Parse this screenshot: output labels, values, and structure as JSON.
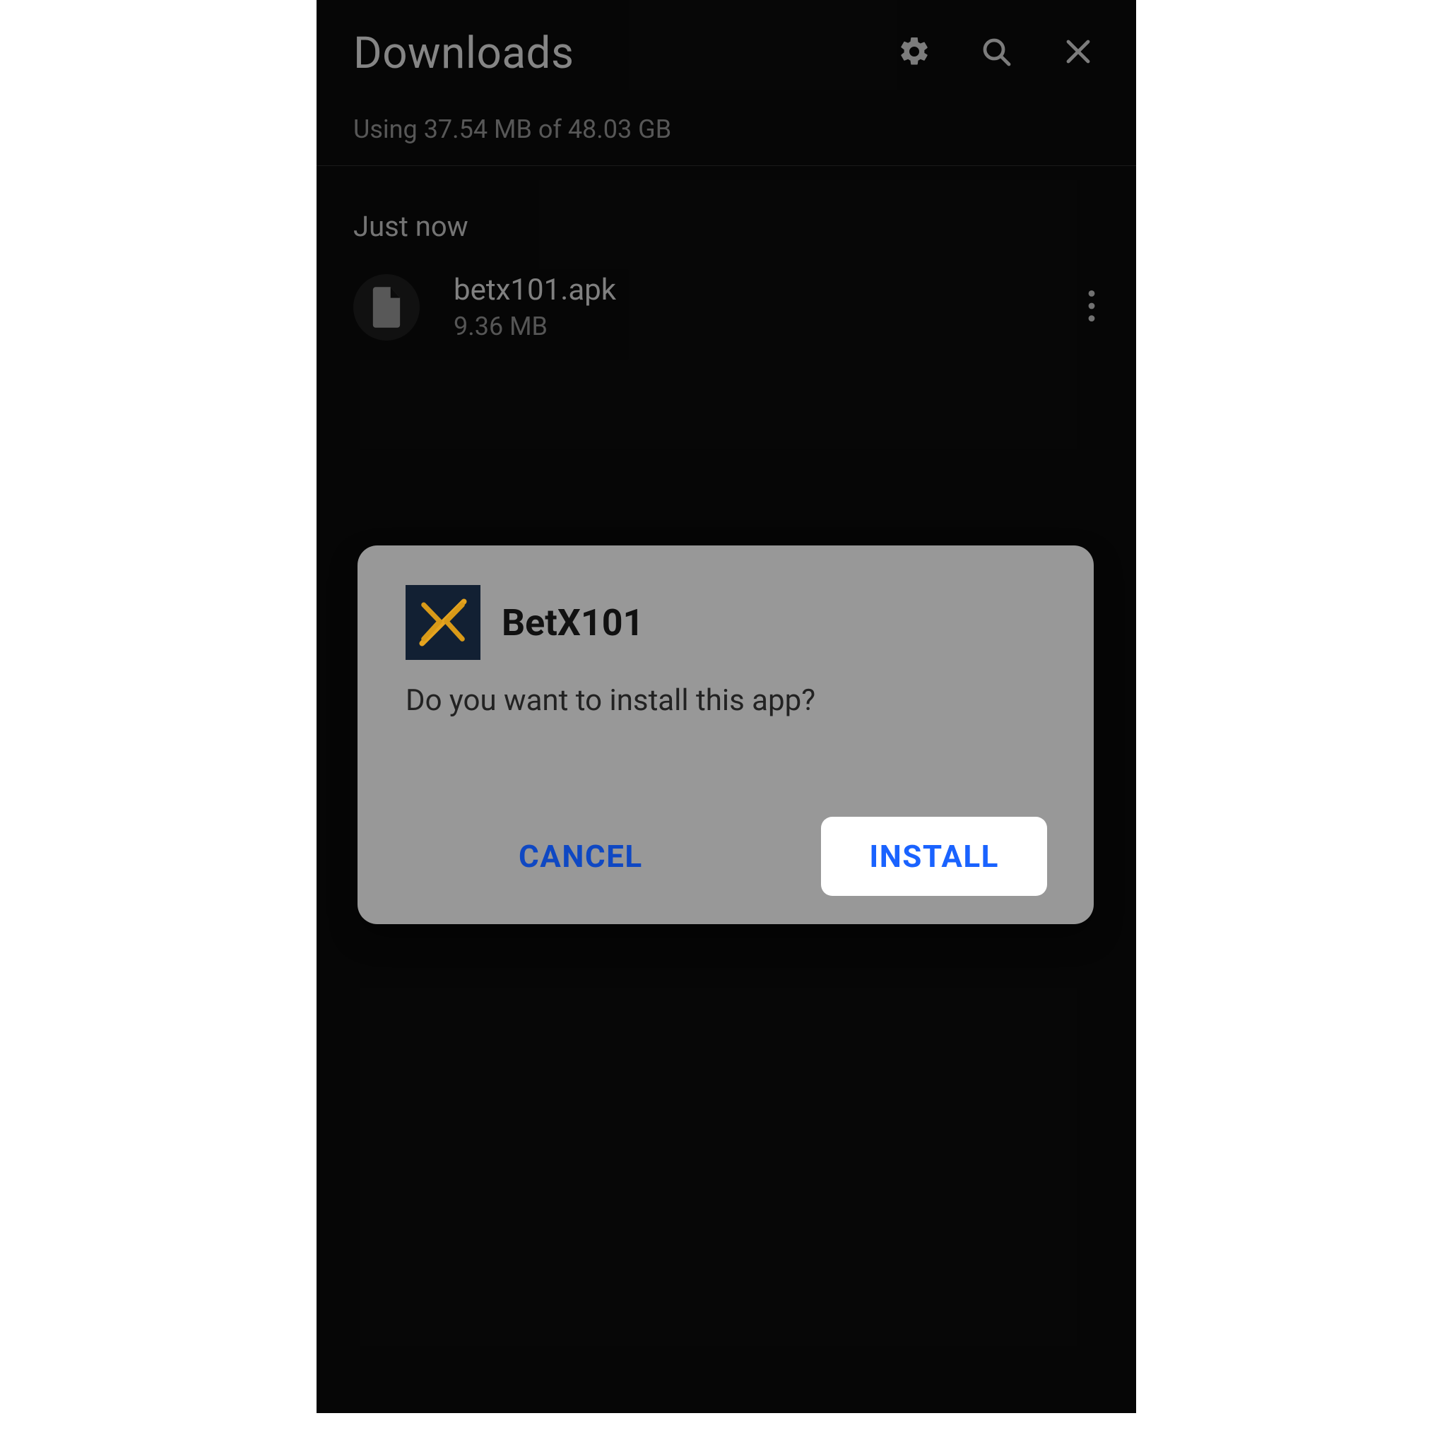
{
  "header": {
    "title": "Downloads",
    "storage_line": "Using 37.54 MB of 48.03 GB"
  },
  "section": {
    "label": "Just now"
  },
  "file": {
    "name": "betx101.apk",
    "size": "9.36 MB"
  },
  "dialog": {
    "app_name": "BetX101",
    "message": "Do you want to install this app?",
    "cancel_label": "CANCEL",
    "install_label": "INSTALL"
  }
}
